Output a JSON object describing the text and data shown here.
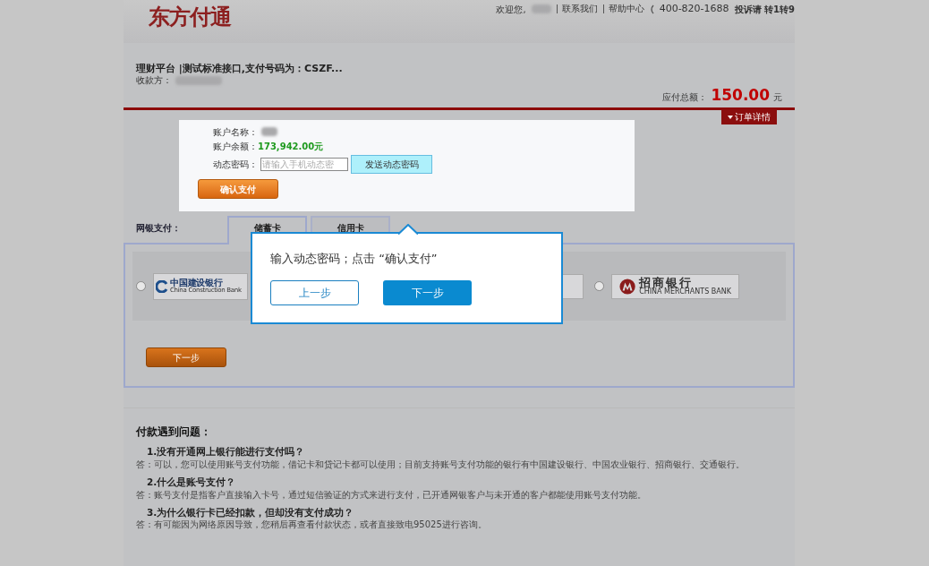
{
  "header": {
    "logo": "东方付通",
    "welcome": "欢迎您,",
    "links": [
      {
        "label": "联系我们"
      },
      {
        "label": "帮助中心"
      }
    ],
    "phone": "400-820-1688",
    "complaint": "投诉请 转1转9"
  },
  "order": {
    "title": "理财平台 |测试标准接口,支付号码为：CSZF...",
    "payee_label": "收款方：",
    "total_label": "应付总额：",
    "total": "150.00",
    "currency": "元",
    "details_button": "订单详情"
  },
  "account": {
    "name_label": "账户名称：",
    "balance_label": "账户余额：",
    "balance": "173,942.00元",
    "code_label": "动态密码：",
    "code_placeholder": "请输入手机动态密",
    "send_button": "发送动态密码",
    "confirm_button": "确认支付"
  },
  "netbank": {
    "label": "网银支付：",
    "tabs": [
      {
        "label": "储蓄卡",
        "selected": true
      },
      {
        "label": "信用卡",
        "selected": false
      }
    ],
    "banks": [
      {
        "kind": "ccb",
        "name": "中国建设银行",
        "english": "China Construction Bank",
        "selected": false
      },
      {
        "kind": "cmb",
        "name": "招商银行",
        "english": "CHINA MERCHANTS BANK",
        "selected": false
      }
    ],
    "next_button": "下一步"
  },
  "guide": {
    "text": "输入动态密码；点击 “确认支付”",
    "prev_button": "上一步",
    "next_button": "下一步"
  },
  "faq": {
    "title": "付款遇到问题：",
    "items": [
      {
        "question": "1.没有开通网上银行能进行支付吗？",
        "answer": "答：可以，您可以使用账号支付功能，借记卡和贷记卡都可以使用；目前支持账号支付功能的银行有中国建设银行、中国农业银行、招商银行、交通银行。"
      },
      {
        "question": "2.什么是账号支付？",
        "answer": "答：账号支付是指客户直接输入卡号，通过短信验证的方式来进行支付，已开通网银客户与未开通的客户都能使用账号支付功能。"
      },
      {
        "question": "3.为什么银行卡已经扣款，但却没有支付成功？",
        "answer": "答：有可能因为网络原因导致，您稍后再查看付款状态，或者直接致电95025进行咨询。"
      }
    ]
  }
}
